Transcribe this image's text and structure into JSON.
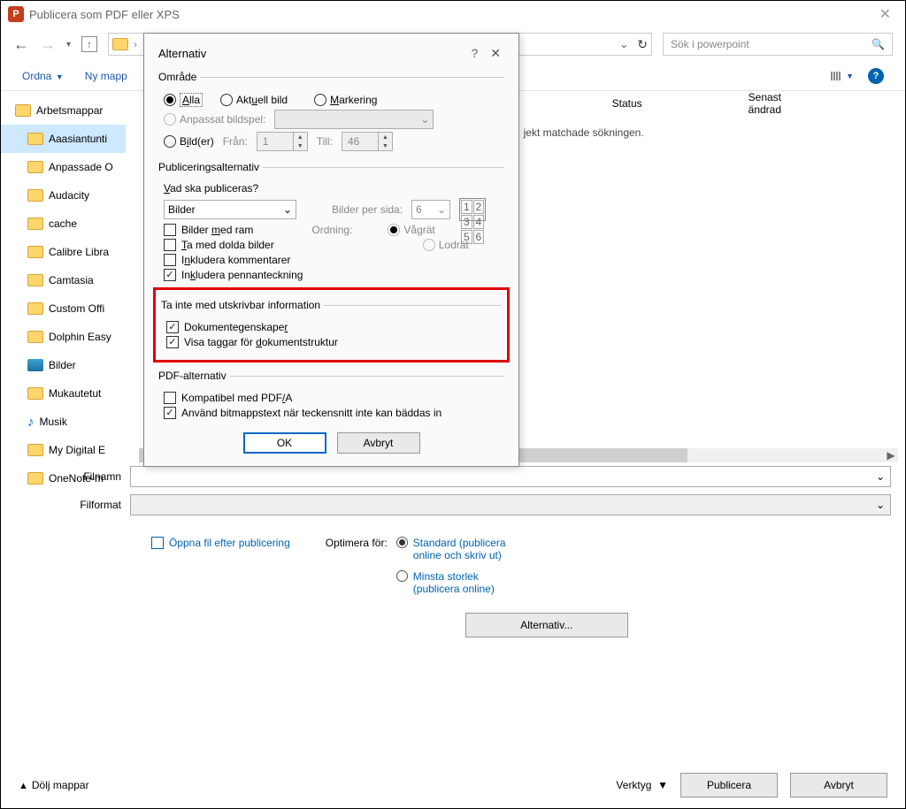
{
  "window": {
    "title": "Publicera som PDF eller XPS",
    "search_placeholder": "Sök i powerpoint"
  },
  "commands": {
    "organize": "Ordna",
    "new_folder": "Ny mapp"
  },
  "tree": {
    "root": "Arbetsmappar",
    "items": [
      "Aaasiantunti",
      "Anpassade O",
      "Audacity",
      "cache",
      "Calibre Libra",
      "Camtasia",
      "Custom Offi",
      "Dolphin Easy",
      "Bilder",
      "Mukautetut",
      "Musik",
      "My Digital E",
      "OneNote-m"
    ]
  },
  "listing": {
    "col_status": "Status",
    "col_modified": "Senast ändrad",
    "no_match": "jekt matchade sökningen."
  },
  "filerow": {
    "filename": "Filnamn",
    "fileformat": "Filformat"
  },
  "lower": {
    "open_after": "Öppna fil efter publicering",
    "optimize": "Optimera för:",
    "opt_std_1": "Standard (publicera",
    "opt_std_2": "online och skriv ut)",
    "opt_min_1": "Minsta storlek",
    "opt_min_2": "(publicera online)",
    "alt_btn": "Alternativ..."
  },
  "footer": {
    "hide": "Dölj mappar",
    "tools": "Verktyg",
    "publish": "Publicera",
    "cancel": "Avbryt"
  },
  "modal": {
    "title": "Alternativ",
    "range": {
      "legend": "Område",
      "all": "Alla",
      "current": "Aktuell bild",
      "selection": "Markering",
      "custom_show": "Anpassat bildspel:",
      "slides": "Bild(er)",
      "from_lbl": "Från:",
      "from_val": "1",
      "to_lbl": "Till:",
      "to_val": "46"
    },
    "pub": {
      "legend": "Publiceringsalternativ",
      "what": "Vad ska publiceras?",
      "what_val": "Bilder",
      "per_page_lbl": "Bilder per sida:",
      "per_page_val": "6",
      "order_lbl": "Ordning:",
      "order_h": "Vågrät",
      "order_v": "Lodrät",
      "frame": "Bilder med ram",
      "hidden": "Ta med dolda bilder",
      "comments": "Inkludera kommentarer",
      "ink": "Inkludera pennanteckning"
    },
    "nonprint": {
      "legend": "Ta inte med utskrivbar information",
      "props": "Dokumentegenskaper",
      "tags": "Visa taggar för dokumentstruktur"
    },
    "pdf": {
      "legend": "PDF-alternativ",
      "pdfa": "Kompatibel med PDF/A",
      "bitmap": "Använd bitmappstext när teckensnitt inte kan bäddas in"
    },
    "ok": "OK",
    "cancel": "Avbryt"
  }
}
